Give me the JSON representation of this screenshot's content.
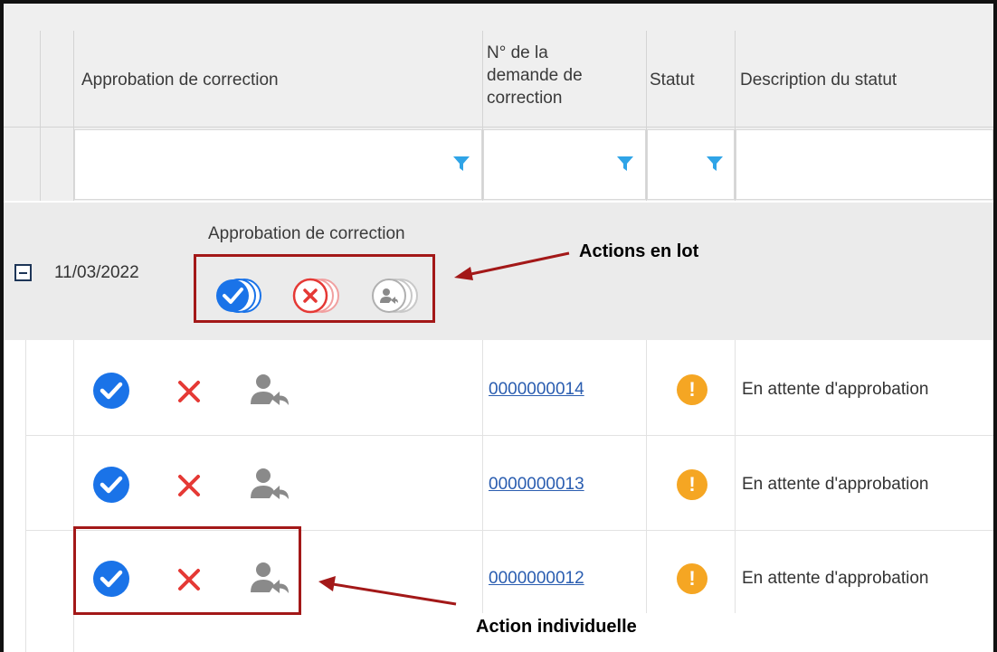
{
  "columns": {
    "approval": "Approbation de correction",
    "request_no": [
      "N° de la",
      "demande de",
      "correction"
    ],
    "status": "Statut",
    "status_desc": "Description du statut"
  },
  "group": {
    "date": "11/03/2022",
    "title": "Approbation de correction",
    "bulk_actions": [
      "approve-all",
      "reject-all",
      "reassign-all"
    ]
  },
  "rows": [
    {
      "request_no": "0000000014",
      "status_icon": "warning-icon",
      "status_desc": "En attente d'approbation"
    },
    {
      "request_no": "0000000013",
      "status_icon": "warning-icon",
      "status_desc": "En attente d'approbation"
    },
    {
      "request_no": "0000000012",
      "status_icon": "warning-icon",
      "status_desc": "En attente d'approbation"
    }
  ],
  "annotations": {
    "bulk": "Actions en lot",
    "individual": "Action individuelle"
  },
  "colors": {
    "approve": "#1a73e8",
    "reject": "#e53935",
    "reassign": "#8a8a8a",
    "warning": "#f5a623",
    "annotation": "#a31818"
  }
}
